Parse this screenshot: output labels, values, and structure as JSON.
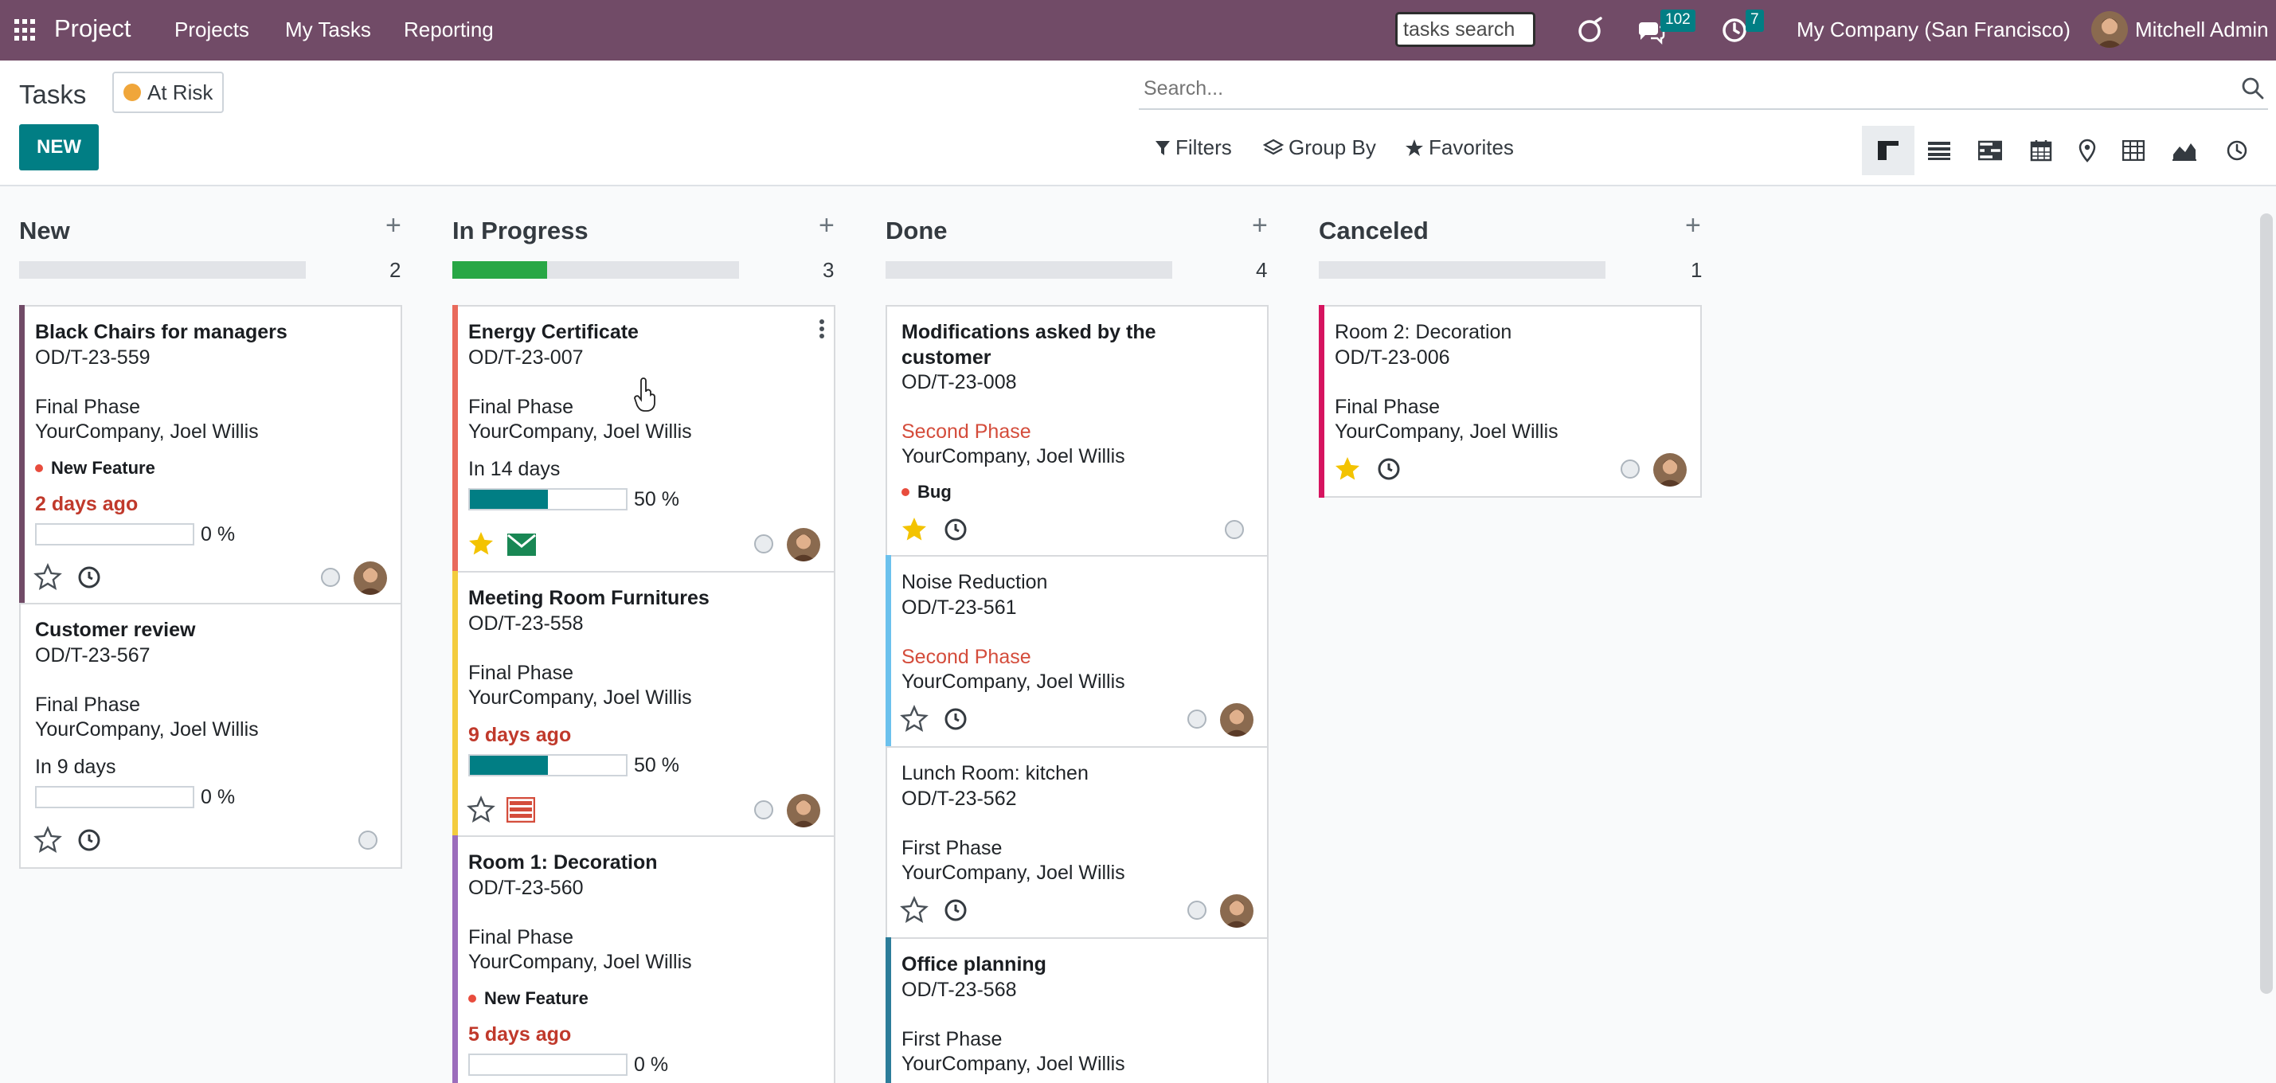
{
  "navbar": {
    "app_name": "Project",
    "menu": [
      "Projects",
      "My Tasks",
      "Reporting"
    ],
    "tasks_search": "tasks search",
    "messages_count": "102",
    "activities_count": "7",
    "company": "My Company (San Francisco)",
    "user": "Mitchell Admin",
    "icons": [
      "apps-grid-icon",
      "discuss-swirl-icon",
      "chat-bubbles-icon",
      "clock-icon"
    ]
  },
  "control": {
    "title": "Tasks",
    "filter_chip": "At Risk",
    "new_label": "NEW",
    "search_placeholder": "Search...",
    "filters_label": "Filters",
    "group_by_label": "Group By",
    "favorites_label": "Favorites",
    "views": [
      "kanban-view-icon",
      "list-view-icon",
      "gantt-view-icon",
      "calendar-view-icon",
      "map-view-icon",
      "pivot-view-icon",
      "graph-view-icon",
      "activity-view-icon"
    ]
  },
  "columns": [
    {
      "name": "New",
      "count": "2",
      "progress": 0,
      "cards": [
        {
          "title": "Black Chairs for managers",
          "ref": "OD/T-23-559",
          "stage": "Final Phase",
          "partner": "YourCompany, Joel Willis",
          "tag": "New Feature",
          "deadline": "2 days ago",
          "progress": "0 %",
          "progress_value": 0,
          "stripe": "#714b67"
        },
        {
          "title": "Customer review",
          "ref": "OD/T-23-567",
          "stage": "Final Phase",
          "partner": "YourCompany, Joel Willis",
          "deadline": "In 9 days",
          "progress": "0 %",
          "progress_value": 0
        }
      ]
    },
    {
      "name": "In Progress",
      "count": "3",
      "progress": 0.33,
      "cards": [
        {
          "title": "Energy Certificate",
          "ref": "OD/T-23-007",
          "stage": "Final Phase",
          "partner": "YourCompany, Joel Willis",
          "deadline": "In 14 days",
          "progress": "50 %",
          "progress_value": 0.5,
          "stripe": "#e96a5c"
        },
        {
          "title": "Meeting Room Furnitures",
          "ref": "OD/T-23-558",
          "stage": "Final Phase",
          "partner": "YourCompany, Joel Willis",
          "deadline": "9 days ago",
          "progress": "50 %",
          "progress_value": 0.5,
          "stripe": "#f3cc3e"
        },
        {
          "title": "Room 1: Decoration",
          "ref": "OD/T-23-560",
          "stage": "Final Phase",
          "partner": "YourCompany, Joel Willis",
          "tag": "New Feature",
          "deadline": "5 days ago",
          "progress": "0 %",
          "progress_value": 0,
          "stripe": "#9c6dbc"
        }
      ]
    },
    {
      "name": "Done",
      "count": "4",
      "progress": 0,
      "cards": [
        {
          "title_line1": "Modifications asked by the",
          "title_line2": "customer",
          "ref": "OD/T-23-008",
          "stage": "Second Phase",
          "partner": "YourCompany, Joel Willis",
          "tag": "Bug"
        },
        {
          "title": "Noise Reduction",
          "ref": "OD/T-23-561",
          "stage": "Second Phase",
          "partner": "YourCompany, Joel Willis",
          "stripe": "#6cc1ed"
        },
        {
          "title": "Lunch Room: kitchen",
          "ref": "OD/T-23-562",
          "stage": "First Phase",
          "partner": "YourCompany, Joel Willis"
        },
        {
          "title": "Office planning",
          "ref": "OD/T-23-568",
          "stage": "First Phase",
          "partner": "YourCompany, Joel Willis",
          "stripe": "#2c7d9a"
        }
      ]
    },
    {
      "name": "Canceled",
      "count": "1",
      "progress": 0,
      "cards": [
        {
          "title": "Room 2: Decoration",
          "ref": "OD/T-23-006",
          "stage": "Final Phase",
          "partner": "YourCompany, Joel Willis",
          "stripe": "#d6145f"
        }
      ]
    }
  ],
  "colors": {
    "navbar": "#714b67",
    "primary": "#017e84",
    "danger": "#d44c3b",
    "star": "#f3c300"
  }
}
